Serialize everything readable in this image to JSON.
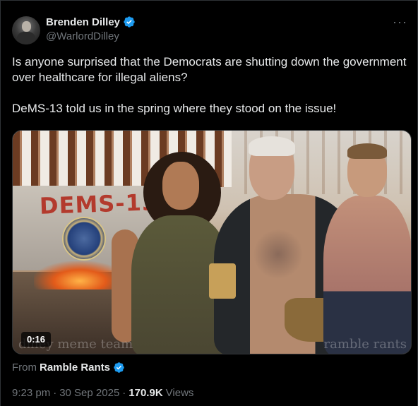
{
  "author": {
    "display_name": "Brenden Dilley",
    "handle": "@WarlordDilley",
    "verified_icon": "verified-badge-icon"
  },
  "more_label": "···",
  "tweet": {
    "paragraphs": [
      "Is anyone surprised that the Democrats are shutting down the government over healthcare for illegal aliens?",
      "DeMS-13 told us in the spring where they stood on the issue!"
    ]
  },
  "media": {
    "duration": "0:16",
    "graffiti_text": "DEMS-13",
    "watermark_left": "dilley meme team",
    "watermark_right": "ramble rants"
  },
  "source": {
    "prefix": "From",
    "name": "Ramble Rants",
    "verified_icon": "verified-badge-icon"
  },
  "meta": {
    "time": "9:23 pm",
    "separator": "·",
    "date": "30 Sep 2025",
    "views_count": "170.9K",
    "views_label": "Views"
  },
  "colors": {
    "background": "#000000",
    "text_primary": "#e7e9ea",
    "text_secondary": "#71767b",
    "verified_blue": "#1d9bf0"
  }
}
